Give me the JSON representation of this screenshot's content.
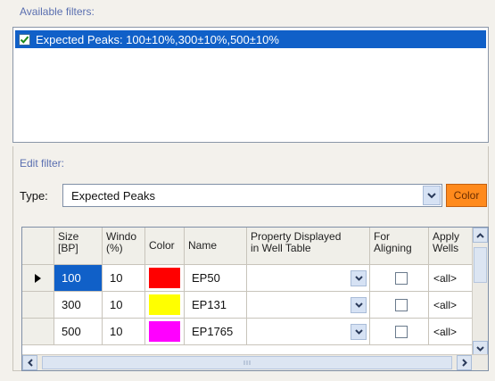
{
  "available_filters": {
    "title": "Available filters:",
    "items": [
      {
        "label": "Expected Peaks: 100±10%,300±10%,500±10%",
        "checked": true
      }
    ]
  },
  "edit_filter": {
    "title": "Edit filter:",
    "type_label": "Type:",
    "type_value": "Expected Peaks",
    "color_button_label": "Color",
    "color_button_color": "#ff8a1c"
  },
  "grid": {
    "headers": [
      "Size\n[BP]",
      "Windo\n(%)",
      "Color",
      "Name",
      "Property Displayed\nin Well Table",
      "For\nAligning",
      "Apply\nWells"
    ],
    "rows": [
      {
        "size": "100",
        "window": "10",
        "color": "#ff0000",
        "name": "EP50",
        "property": "",
        "apply": "<all>",
        "current": true
      },
      {
        "size": "300",
        "window": "10",
        "color": "#ffff00",
        "name": "EP131",
        "property": "",
        "apply": "<all>",
        "current": false
      },
      {
        "size": "500",
        "window": "10",
        "color": "#ff00ff",
        "name": "EP1765",
        "property": "",
        "apply": "<all>",
        "current": false
      }
    ]
  },
  "colors": {
    "selection": "#1060c8",
    "accent": "#ff8a1c"
  }
}
